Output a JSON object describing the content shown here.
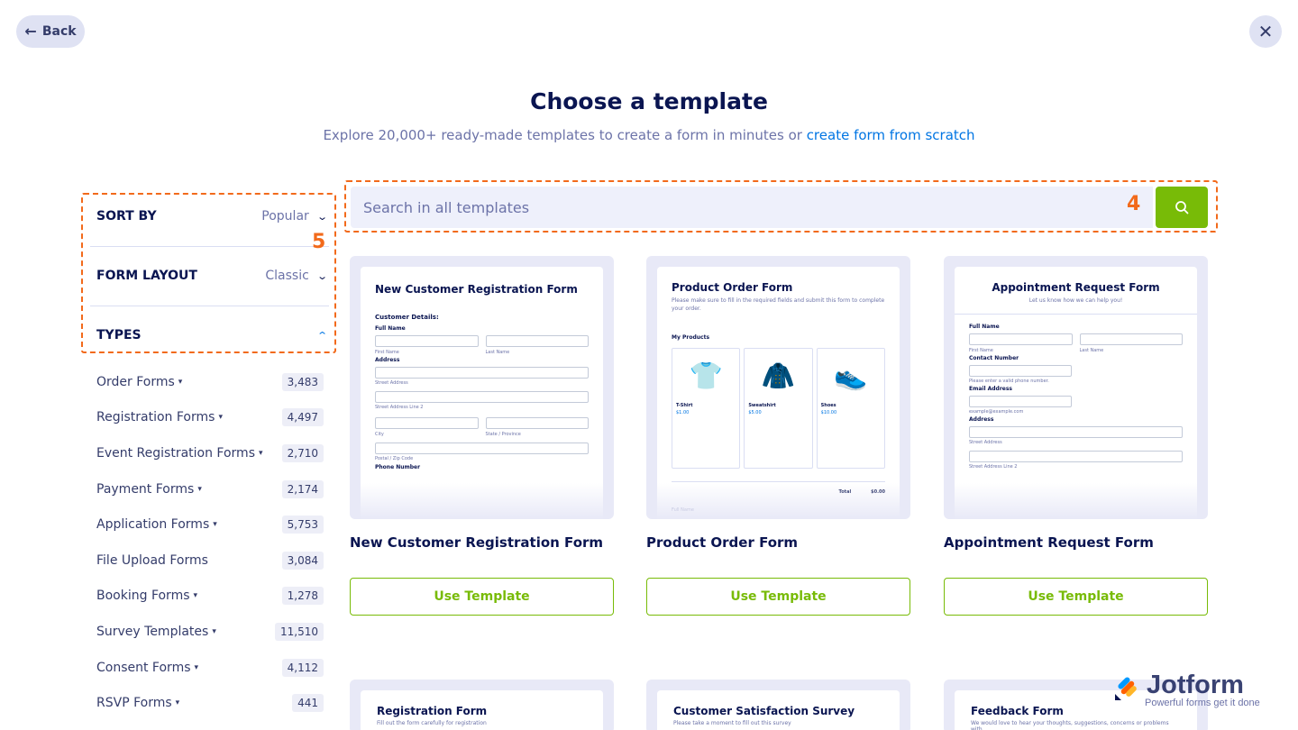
{
  "header": {
    "back_label": "Back",
    "title": "Choose a template",
    "subtitle_prefix": "Explore 20,000+ ready-made templates to create a form in minutes or ",
    "subtitle_link": "create form from scratch"
  },
  "filters": {
    "sort_by": {
      "label": "SORT BY",
      "value": "Popular"
    },
    "form_layout": {
      "label": "FORM LAYOUT",
      "value": "Classic"
    },
    "types": {
      "label": "TYPES"
    }
  },
  "callouts": {
    "filters_number": "5",
    "search_number": "4"
  },
  "types": [
    {
      "name": "Order Forms",
      "count": "3,483",
      "has_sub": true
    },
    {
      "name": "Registration Forms",
      "count": "4,497",
      "has_sub": true
    },
    {
      "name": "Event Registration Forms",
      "count": "2,710",
      "has_sub": true
    },
    {
      "name": "Payment Forms",
      "count": "2,174",
      "has_sub": true
    },
    {
      "name": "Application Forms",
      "count": "5,753",
      "has_sub": true
    },
    {
      "name": "File Upload Forms",
      "count": "3,084",
      "has_sub": false
    },
    {
      "name": "Booking Forms",
      "count": "1,278",
      "has_sub": true
    },
    {
      "name": "Survey Templates",
      "count": "11,510",
      "has_sub": true
    },
    {
      "name": "Consent Forms",
      "count": "4,112",
      "has_sub": true
    },
    {
      "name": "RSVP Forms",
      "count": "441",
      "has_sub": true
    }
  ],
  "search": {
    "placeholder": "Search in all templates"
  },
  "templates": [
    {
      "name": "New Customer Registration Form",
      "preview_title": "New Customer Registration Form",
      "section": "Customer Details:",
      "labels": [
        "Full Name",
        "First Name",
        "Last Name",
        "Address",
        "Street Address",
        "Street Address Line 2",
        "City",
        "State / Province",
        "Postal / Zip Code",
        "Phone Number"
      ],
      "button": "Use Template"
    },
    {
      "name": "Product Order Form",
      "preview_title": "Product Order Form",
      "preview_sub": "Please make sure to fill in the required fields and submit this form to complete your order.",
      "section": "My Products",
      "products": [
        {
          "name": "T-Shirt",
          "price": "$1.00"
        },
        {
          "name": "Sweatshirt",
          "price": "$5.00"
        },
        {
          "name": "Shoes",
          "price": "$10.00"
        }
      ],
      "total_label": "Total",
      "total_value": "$0.00",
      "footer_label": "Full Name",
      "button": "Use Template"
    },
    {
      "name": "Appointment Request Form",
      "preview_title": "Appointment Request Form",
      "preview_sub": "Let us know how we can help you!",
      "labels": [
        "Full Name",
        "First Name",
        "Last Name",
        "Contact Number",
        "Please enter a valid phone number.",
        "Email Address",
        "example@example.com",
        "Address",
        "Street Address",
        "Street Address Line 2"
      ],
      "button": "Use Template"
    }
  ],
  "templates_row2": [
    {
      "preview_title": "Registration Form",
      "preview_sub": "Fill out the form carefully for registration"
    },
    {
      "preview_title": "Customer Satisfaction Survey",
      "preview_sub": "Please take a moment to fill out this survey"
    },
    {
      "preview_title": "Feedback Form",
      "preview_sub": "We would love to hear your thoughts, suggestions, concerns or problems with"
    }
  ],
  "watermark": {
    "name": "Jotform",
    "tagline": "Powerful forms get it done"
  },
  "colors": {
    "accent_green": "#78bb07",
    "callout_orange": "#f26a1b",
    "link_blue": "#0075e3",
    "navy": "#0a1551"
  }
}
